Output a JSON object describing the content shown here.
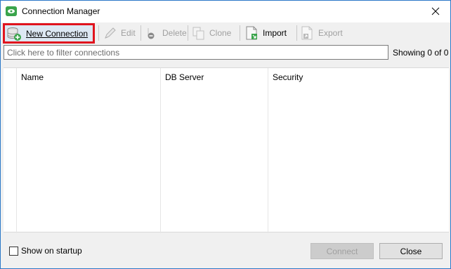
{
  "window": {
    "title": "Connection Manager"
  },
  "toolbar": {
    "new_connection_underline": "N",
    "new_connection_rest": "ew Connection",
    "edit": "Edit",
    "delete": "Delete",
    "clone": "Clone",
    "import": "Import",
    "export": "Export"
  },
  "filter": {
    "placeholder": "Click here to filter connections",
    "showing_text": "Showing 0 of 0"
  },
  "table": {
    "columns": [
      "Name",
      "DB Server",
      "Security"
    ],
    "rows": []
  },
  "footer": {
    "show_on_startup_label": "Show on startup",
    "show_on_startup_checked": false,
    "connect_label": "Connect",
    "close_label": "Close"
  },
  "colors": {
    "highlight_border": "#e0141e",
    "accent_green": "#3aa44b",
    "window_border": "#2b78c8"
  },
  "icons": [
    "app-icon",
    "close-icon",
    "database-add-icon",
    "pencil-icon",
    "delete-icon",
    "clone-icon",
    "import-icon",
    "export-icon",
    "checkbox"
  ]
}
